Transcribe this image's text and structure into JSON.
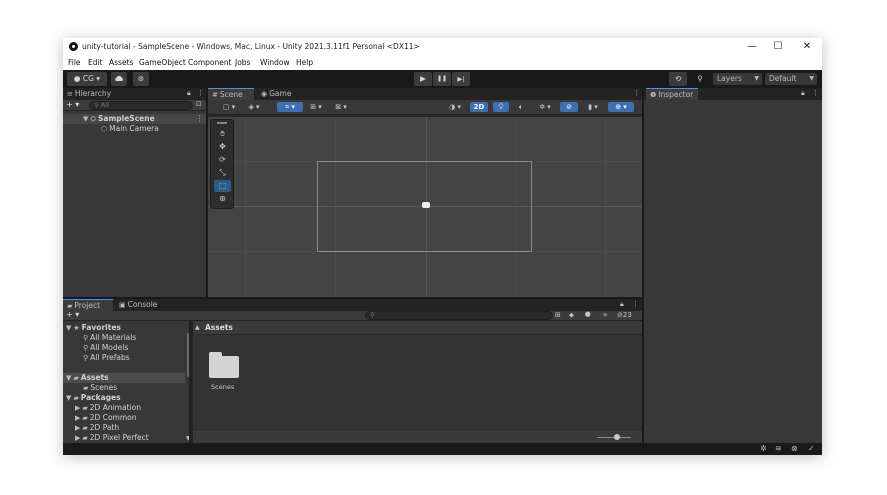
{
  "window": {
    "title": "unity-tutorial - SampleScene - Windows, Mac, Linux - Unity 2021.3.11f1 Personal <DX11>",
    "minimize": "—",
    "maximize": "☐",
    "close": "✕"
  },
  "menu": [
    "File",
    "Edit",
    "Assets",
    "GameObject",
    "Component",
    "Jobs",
    "Window",
    "Help"
  ],
  "toolbar": {
    "account_label": "CG ▾",
    "cloud_icon": "cloud-icon",
    "collab_icon": "collab-icon",
    "play_glyph": "▶",
    "pause_glyph": "❚❚",
    "step_glyph": "▶|",
    "history_glyph": "⟲",
    "search_glyph": "⚲",
    "layers_label": "Layers",
    "layout_label": "Default"
  },
  "hierarchy": {
    "tab_label": "Hierarchy",
    "add_label": "+ ▾",
    "search_placeholder": "All",
    "scene": "SampleScene",
    "children": [
      "Main Camera"
    ]
  },
  "scene": {
    "tab_scene": "Scene",
    "tab_game": "Game",
    "mode_2d": "2D"
  },
  "inspector": {
    "tab_label": "Inspector"
  },
  "project": {
    "tab_project": "Project",
    "tab_console": "Console",
    "add_label": "+ ▾",
    "hidden_count": "23",
    "breadcrumb": "Assets",
    "favorites_label": "Favorites",
    "favorites": [
      "All Materials",
      "All Models",
      "All Prefabs"
    ],
    "assets_label": "Assets",
    "asset_children": [
      "Scenes"
    ],
    "packages_label": "Packages",
    "packages": [
      "2D Animation",
      "2D Common",
      "2D Path",
      "2D Pixel Perfect"
    ],
    "grid_items": [
      {
        "name": "Scenes"
      }
    ]
  }
}
